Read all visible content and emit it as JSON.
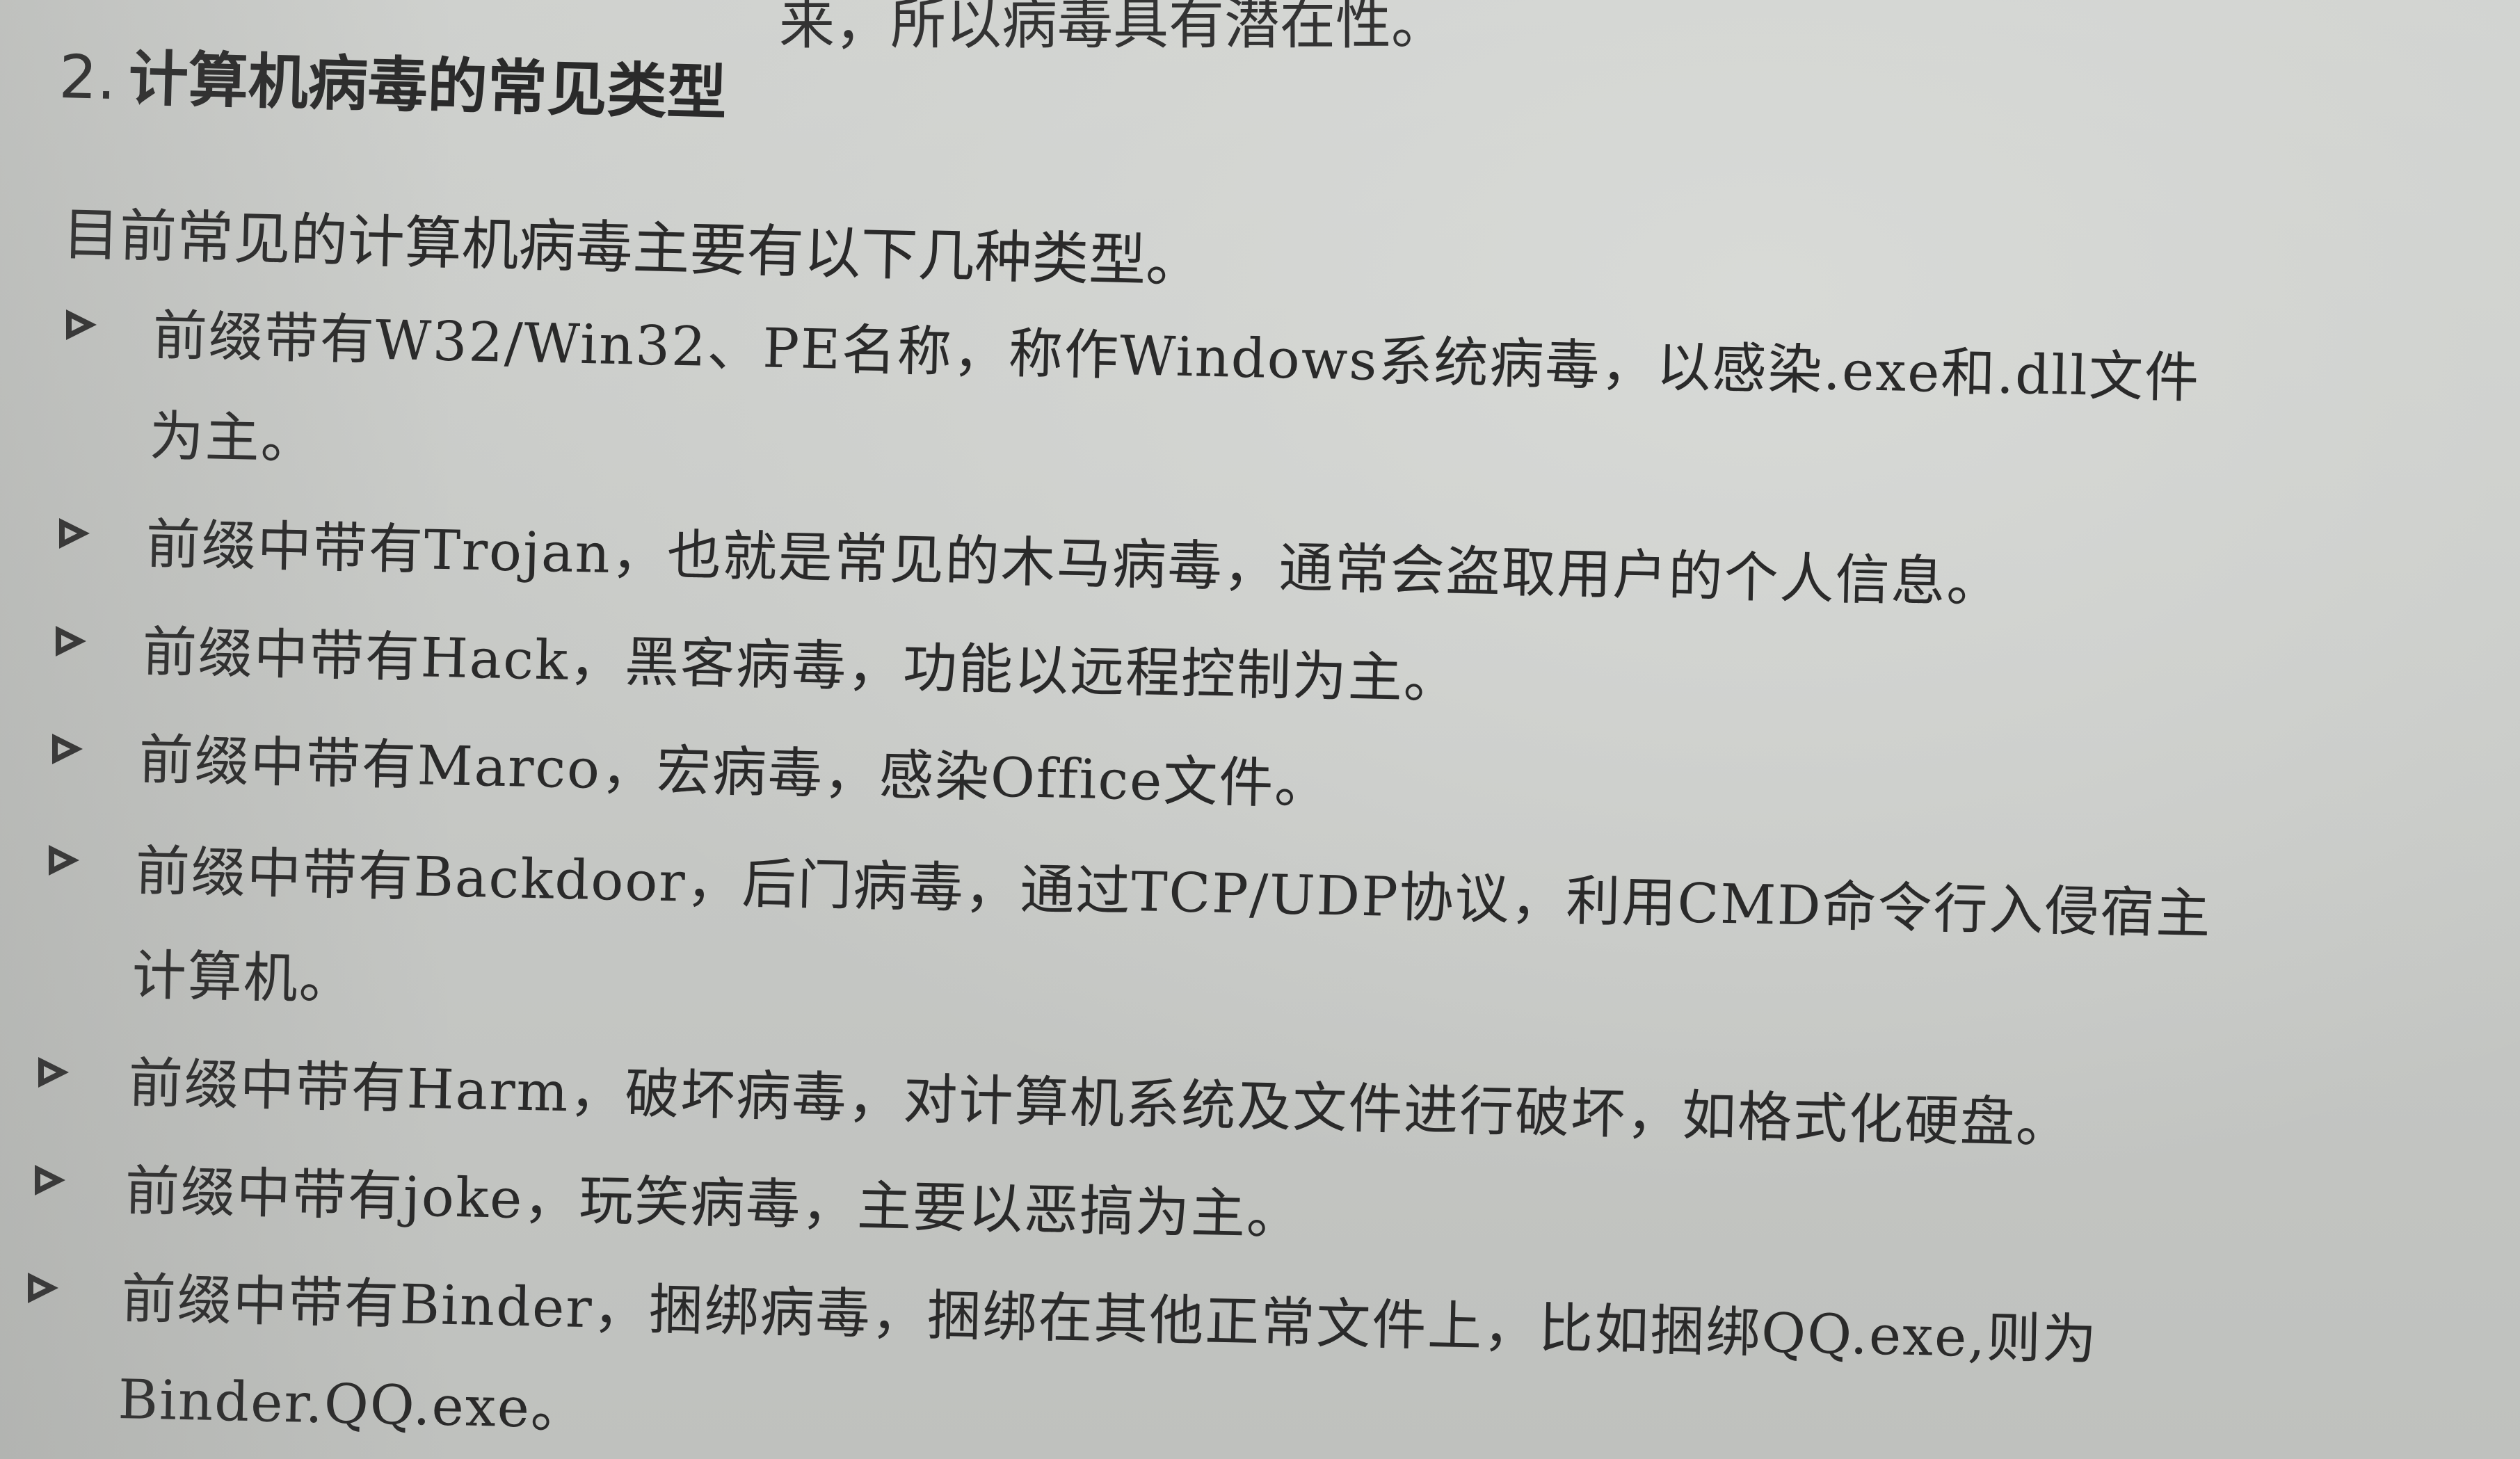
{
  "top_fragment": "来，所以病毒具有潜在性。",
  "section": {
    "number": "2.",
    "title": "计算机病毒的常见类型"
  },
  "intro": "目前常见的计算机病毒主要有以下几种类型。",
  "items": [
    {
      "line1": "前缀带有W32/Win32、PE名称，称作Windows系统病毒，以感染.exe和.dll文件",
      "line2": "为主。"
    },
    {
      "line1": "前缀中带有Trojan，也就是常见的木马病毒，通常会盗取用户的个人信息。"
    },
    {
      "line1": "前缀中带有Hack，黑客病毒，功能以远程控制为主。"
    },
    {
      "line1": "前缀中带有Marco，宏病毒，感染Office文件。"
    },
    {
      "line1": "前缀中带有Backdoor，后门病毒，通过TCP/UDP协议，利用CMD命令行入侵宿主",
      "line2": "计算机。"
    },
    {
      "line1": "前缀中带有Harm，破坏病毒，对计算机系统及文件进行破坏，如格式化硬盘。"
    },
    {
      "line1": "前缀中带有joke，玩笑病毒，主要以恶搞为主。"
    },
    {
      "line1": "前缀中带有Binder，捆绑病毒，捆绑在其他正常文件上，比如捆绑QQ.exe,则为",
      "line2": "Binder.QQ.exe。"
    }
  ]
}
